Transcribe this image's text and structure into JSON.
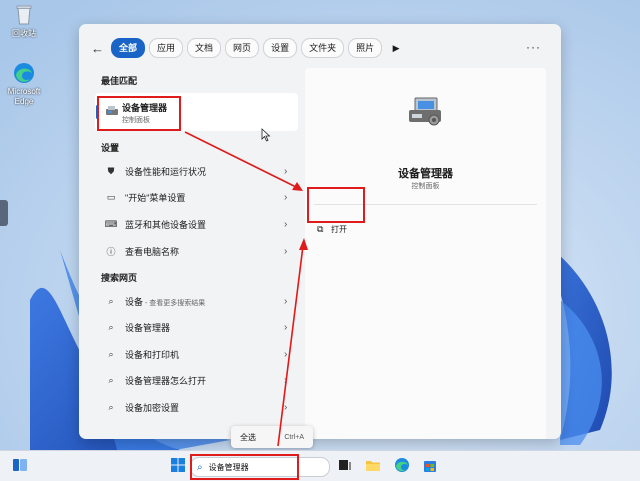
{
  "desktop": {
    "icons": [
      {
        "label": "回收站",
        "icon": "recycle-bin-icon"
      },
      {
        "label": "Microsoft Edge",
        "icon": "edge-icon"
      }
    ]
  },
  "search_panel": {
    "filters": [
      "全部",
      "应用",
      "文档",
      "网页",
      "设置",
      "文件夹",
      "照片"
    ],
    "active_filter": "全部",
    "best_match": {
      "section": "最佳匹配",
      "title": "设备管理器",
      "subtitle": "控制面板"
    },
    "settings": {
      "section": "设置",
      "items": [
        {
          "label": "设备性能和运行状况",
          "icon": "shield-icon"
        },
        {
          "label": "\"开始\"菜单设置",
          "icon": "start-menu-icon"
        },
        {
          "label": "蓝牙和其他设备设置",
          "icon": "devices-icon"
        },
        {
          "label": "查看电脑名称",
          "icon": "info-icon"
        }
      ]
    },
    "web": {
      "section": "搜索网页",
      "items": [
        {
          "label": "设备",
          "sub": " - 查看更多搜索结果"
        },
        {
          "label": "设备管理器",
          "sub": ""
        },
        {
          "label": "设备和打印机",
          "sub": ""
        },
        {
          "label": "设备管理器怎么打开",
          "sub": ""
        },
        {
          "label": "设备加密设置",
          "sub": ""
        }
      ]
    },
    "detail": {
      "title": "设备管理器",
      "subtitle": "控制面板",
      "open_label": "打开"
    }
  },
  "tooltip": {
    "label": "全选",
    "shortcut": "Ctrl+A"
  },
  "taskbar": {
    "search_value": "设备管理器",
    "icons": [
      "widgets-icon",
      "windows-start-icon",
      "search-icon",
      "task-view-icon",
      "file-explorer-icon",
      "edge-icon",
      "store-icon"
    ]
  },
  "colors": {
    "accent": "#1a64c8",
    "annotation": "#e01b1b"
  }
}
